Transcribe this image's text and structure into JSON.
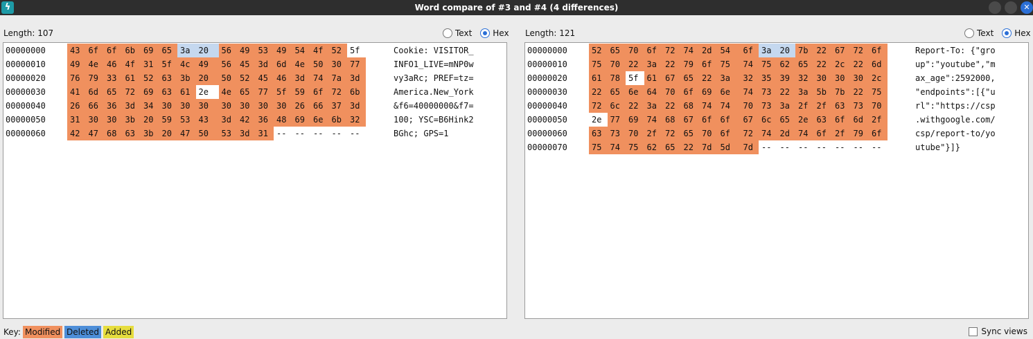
{
  "window": {
    "title": "Word compare of #3 and #4  (4 differences)",
    "icon": "lightning-icon"
  },
  "left": {
    "length_label": "Length: 107",
    "view_mode": "Hex",
    "radio_text": "Text",
    "radio_hex": "Hex",
    "rows": [
      {
        "addr": "00000000",
        "ascii": "Cookie: VISITOR_"
      },
      {
        "addr": "00000010",
        "ascii": "INFO1_LIVE=mNP0w"
      },
      {
        "addr": "00000020",
        "ascii": "vy3aRc; PREF=tz="
      },
      {
        "addr": "00000030",
        "ascii": "America.New_York"
      },
      {
        "addr": "00000040",
        "ascii": "&f6=40000000&f7="
      },
      {
        "addr": "00000050",
        "ascii": "100; YSC=B6Hink2"
      },
      {
        "addr": "00000060",
        "ascii": "BGhc; GPS=1"
      }
    ],
    "bytes": [
      [
        "43",
        "6f",
        "6f",
        "6b",
        "69",
        "65",
        "3a",
        "20",
        "56",
        "49",
        "53",
        "49",
        "54",
        "4f",
        "52",
        "5f"
      ],
      [
        "49",
        "4e",
        "46",
        "4f",
        "31",
        "5f",
        "4c",
        "49",
        "56",
        "45",
        "3d",
        "6d",
        "4e",
        "50",
        "30",
        "77"
      ],
      [
        "76",
        "79",
        "33",
        "61",
        "52",
        "63",
        "3b",
        "20",
        "50",
        "52",
        "45",
        "46",
        "3d",
        "74",
        "7a",
        "3d"
      ],
      [
        "41",
        "6d",
        "65",
        "72",
        "69",
        "63",
        "61",
        "2e",
        "4e",
        "65",
        "77",
        "5f",
        "59",
        "6f",
        "72",
        "6b"
      ],
      [
        "26",
        "66",
        "36",
        "3d",
        "34",
        "30",
        "30",
        "30",
        "30",
        "30",
        "30",
        "30",
        "26",
        "66",
        "37",
        "3d"
      ],
      [
        "31",
        "30",
        "30",
        "3b",
        "20",
        "59",
        "53",
        "43",
        "3d",
        "42",
        "36",
        "48",
        "69",
        "6e",
        "6b",
        "32"
      ],
      [
        "42",
        "47",
        "68",
        "63",
        "3b",
        "20",
        "47",
        "50",
        "53",
        "3d",
        "31",
        "--",
        "--",
        "--",
        "--",
        "--"
      ]
    ],
    "states": [
      "mmmmmmssmmmmmmmp",
      "mmmmmmmmmmmmmmmm",
      "mmmmmmmmmmmmmmmm",
      "mmmmmmmpmmmmmmmm",
      "mmmmmmmmmmmmmmmm",
      "mmmmmmmmmmmmmmmm",
      "mmmmmmmmmmmppppp"
    ]
  },
  "right": {
    "length_label": "Length: 121",
    "view_mode": "Hex",
    "radio_text": "Text",
    "radio_hex": "Hex",
    "rows": [
      {
        "addr": "00000000",
        "ascii": "Report-To: {\"gro"
      },
      {
        "addr": "00000010",
        "ascii": "up\":\"youtube\",\"m"
      },
      {
        "addr": "00000020",
        "ascii": "ax_age\":2592000,"
      },
      {
        "addr": "00000030",
        "ascii": "\"endpoints\":[{\"u"
      },
      {
        "addr": "00000040",
        "ascii": "rl\":\"https://csp"
      },
      {
        "addr": "00000050",
        "ascii": ".withgoogle.com/"
      },
      {
        "addr": "00000060",
        "ascii": "csp/report-to/yo"
      },
      {
        "addr": "00000070",
        "ascii": "utube\"}]}"
      }
    ],
    "bytes": [
      [
        "52",
        "65",
        "70",
        "6f",
        "72",
        "74",
        "2d",
        "54",
        "6f",
        "3a",
        "20",
        "7b",
        "22",
        "67",
        "72",
        "6f"
      ],
      [
        "75",
        "70",
        "22",
        "3a",
        "22",
        "79",
        "6f",
        "75",
        "74",
        "75",
        "62",
        "65",
        "22",
        "2c",
        "22",
        "6d"
      ],
      [
        "61",
        "78",
        "5f",
        "61",
        "67",
        "65",
        "22",
        "3a",
        "32",
        "35",
        "39",
        "32",
        "30",
        "30",
        "30",
        "2c"
      ],
      [
        "22",
        "65",
        "6e",
        "64",
        "70",
        "6f",
        "69",
        "6e",
        "74",
        "73",
        "22",
        "3a",
        "5b",
        "7b",
        "22",
        "75"
      ],
      [
        "72",
        "6c",
        "22",
        "3a",
        "22",
        "68",
        "74",
        "74",
        "70",
        "73",
        "3a",
        "2f",
        "2f",
        "63",
        "73",
        "70"
      ],
      [
        "2e",
        "77",
        "69",
        "74",
        "68",
        "67",
        "6f",
        "6f",
        "67",
        "6c",
        "65",
        "2e",
        "63",
        "6f",
        "6d",
        "2f"
      ],
      [
        "63",
        "73",
        "70",
        "2f",
        "72",
        "65",
        "70",
        "6f",
        "72",
        "74",
        "2d",
        "74",
        "6f",
        "2f",
        "79",
        "6f"
      ],
      [
        "75",
        "74",
        "75",
        "62",
        "65",
        "22",
        "7d",
        "5d",
        "7d",
        "--",
        "--",
        "--",
        "--",
        "--",
        "--",
        "--"
      ]
    ],
    "states": [
      "mmmmmmmmmssmmmmm",
      "mmmmmmmmmmmmmmmm",
      "mmpmmmmmmmmmmmmm",
      "mmmmmmmmmmmmmmmm",
      "mmmmmmmmmmmmmmmm",
      "pmmmmmmmmmmmmmmm",
      "mmmmmmmmmmmmmmmm",
      "mmmmmmmmmppppppp"
    ]
  },
  "footer": {
    "key_label": "Key:",
    "modified": "Modified",
    "deleted": "Deleted",
    "added": "Added",
    "sync_views": "Sync views",
    "sync_checked": false
  },
  "colors": {
    "modified": "#f0905e",
    "deleted": "#4d8ed8",
    "added": "#e6dd3e",
    "selection": "#c5d8ef"
  }
}
